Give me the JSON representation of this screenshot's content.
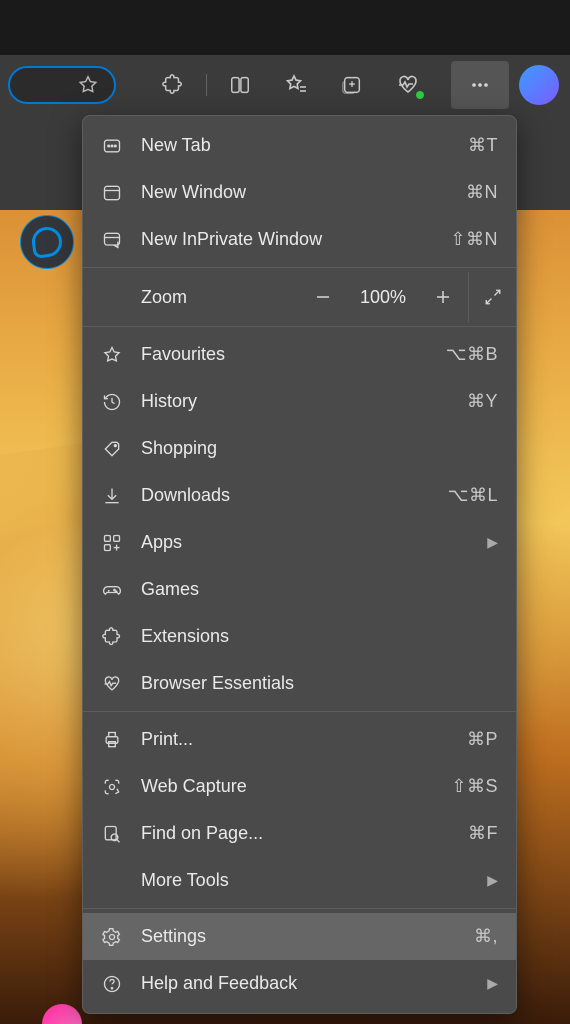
{
  "toolbar": {
    "icons": [
      "star-icon",
      "puzzle-icon",
      "split-screen-icon",
      "sparkle-star-icon",
      "collections-icon",
      "heartbeat-icon",
      "more-icon",
      "copilot-icon"
    ]
  },
  "menu": {
    "zoom": {
      "label": "Zoom",
      "value": "100%"
    },
    "groups": [
      [
        {
          "icon": "new-tab-icon",
          "label": "New Tab",
          "shortcut": "⌘T"
        },
        {
          "icon": "window-icon",
          "label": "New Window",
          "shortcut": "⌘N"
        },
        {
          "icon": "inprivate-icon",
          "label": "New InPrivate Window",
          "shortcut": "⇧⌘N"
        }
      ],
      [
        {
          "icon": "star-icon",
          "label": "Favourites",
          "shortcut": "⌥⌘B"
        },
        {
          "icon": "history-icon",
          "label": "History",
          "shortcut": "⌘Y"
        },
        {
          "icon": "shopping-icon",
          "label": "Shopping",
          "shortcut": ""
        },
        {
          "icon": "download-icon",
          "label": "Downloads",
          "shortcut": "⌥⌘L"
        },
        {
          "icon": "apps-icon",
          "label": "Apps",
          "shortcut": "",
          "submenu": true
        },
        {
          "icon": "games-icon",
          "label": "Games",
          "shortcut": ""
        },
        {
          "icon": "puzzle-icon",
          "label": "Extensions",
          "shortcut": ""
        },
        {
          "icon": "heartbeat-icon",
          "label": "Browser Essentials",
          "shortcut": ""
        }
      ],
      [
        {
          "icon": "print-icon",
          "label": "Print...",
          "shortcut": "⌘P"
        },
        {
          "icon": "capture-icon",
          "label": "Web Capture",
          "shortcut": "⇧⌘S"
        },
        {
          "icon": "find-icon",
          "label": "Find on Page...",
          "shortcut": "⌘F"
        },
        {
          "icon": "",
          "label": "More Tools",
          "shortcut": "",
          "submenu": true
        }
      ],
      [
        {
          "icon": "gear-icon",
          "label": "Settings",
          "shortcut": "⌘,",
          "highlighted": true
        },
        {
          "icon": "help-icon",
          "label": "Help and Feedback",
          "shortcut": "",
          "submenu": true
        }
      ]
    ]
  }
}
